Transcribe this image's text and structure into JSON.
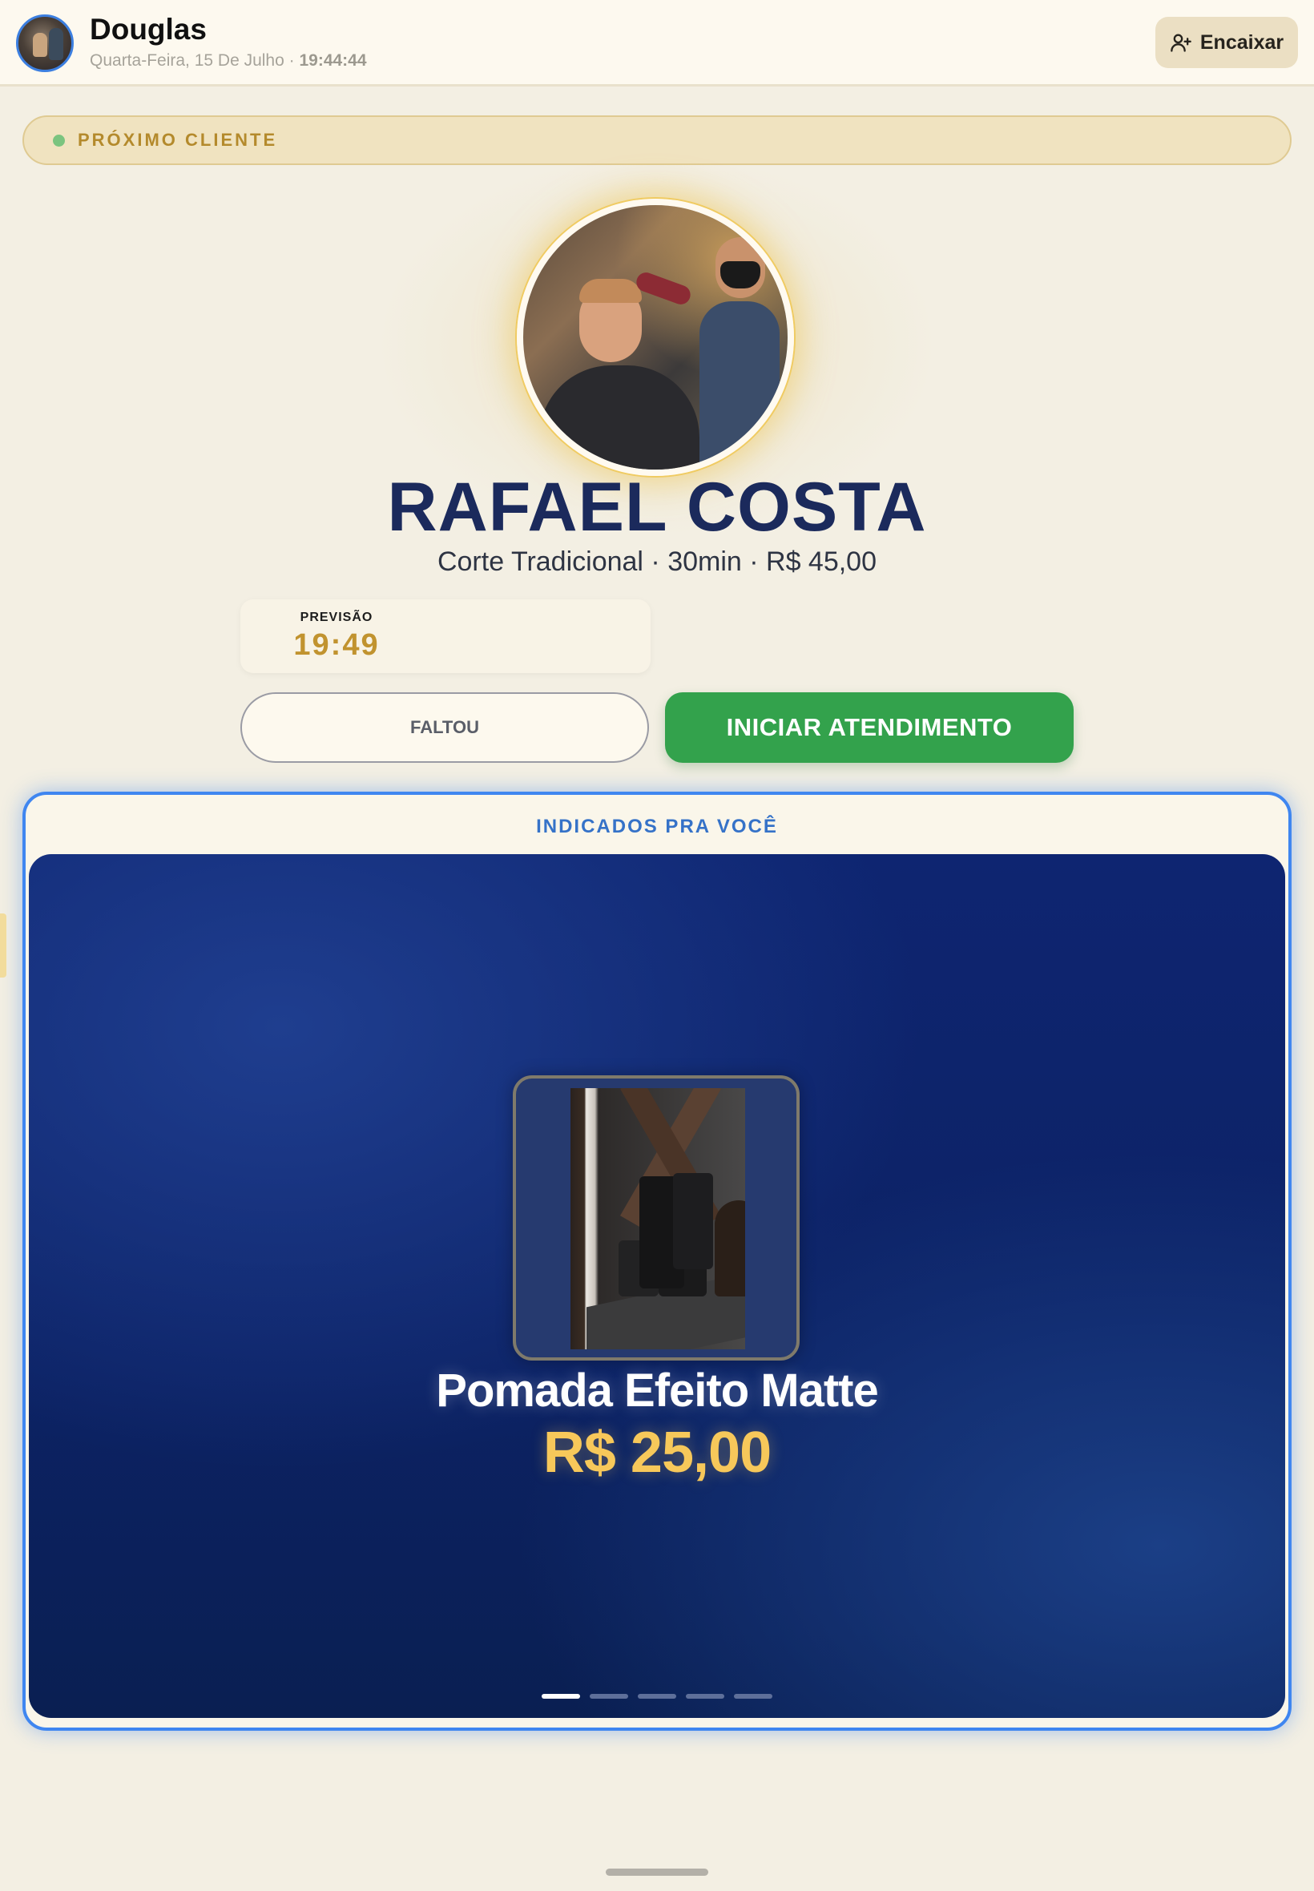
{
  "header": {
    "user_name": "Douglas",
    "date": "Quarta-Feira, 15 De Julho",
    "separator": " · ",
    "time": "19:44:44",
    "encaixar_label": "Encaixar"
  },
  "next_client": {
    "banner_label": "PRÓXIMO CLIENTE",
    "name": "RAFAEL COSTA",
    "service": "Corte Tradicional · 30min · R$ 45,00",
    "preview_label": "PREVISÃO",
    "preview_time": "19:49",
    "faltou_label": "FALTOU",
    "iniciar_label": "INICIAR ATENDIMENTO"
  },
  "recommended": {
    "title": "INDICADOS PRA VOCÊ",
    "product_name": "Pomada Efeito Matte",
    "product_price": "R$ 25,00",
    "slides_total": 5,
    "active_slide": 1
  },
  "icons": {
    "encaixar": "user-plus-icon",
    "status": "green-dot-icon"
  },
  "colors": {
    "primary_green": "#33a24c",
    "accent_gold": "#c1932f",
    "accent_blue": "#3f86f0",
    "stage_navy": "#0e2571",
    "price_yellow": "#f7c85a"
  }
}
